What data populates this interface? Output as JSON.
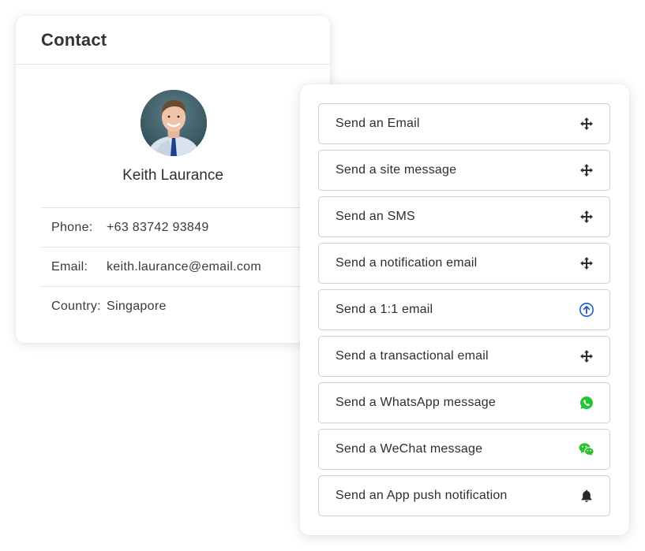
{
  "contact": {
    "title": "Contact",
    "name": "Keith Laurance",
    "details": [
      {
        "label": "Phone:",
        "value": "+63 83742 93849"
      },
      {
        "label": "Email:",
        "value": "keith.laurance@email.com"
      },
      {
        "label": "Country:",
        "value": "Singapore"
      }
    ]
  },
  "actions": [
    {
      "label": "Send an Email",
      "icon": "move-icon"
    },
    {
      "label": "Send a site message",
      "icon": "move-icon"
    },
    {
      "label": "Send an SMS",
      "icon": "move-icon"
    },
    {
      "label": "Send a notification email",
      "icon": "move-icon"
    },
    {
      "label": "Send a 1:1 email",
      "icon": "arrow-up-circle-icon"
    },
    {
      "label": "Send a transactional email",
      "icon": "move-icon"
    },
    {
      "label": "Send a WhatsApp message",
      "icon": "whatsapp-icon"
    },
    {
      "label": "Send a WeChat message",
      "icon": "wechat-icon"
    },
    {
      "label": "Send an App push notification",
      "icon": "bell-icon"
    }
  ],
  "colors": {
    "accent_blue": "#1d5fbf",
    "whatsapp_green": "#25c437",
    "wechat_green": "#2dc12b",
    "icon_dark": "#2b2b2b"
  }
}
